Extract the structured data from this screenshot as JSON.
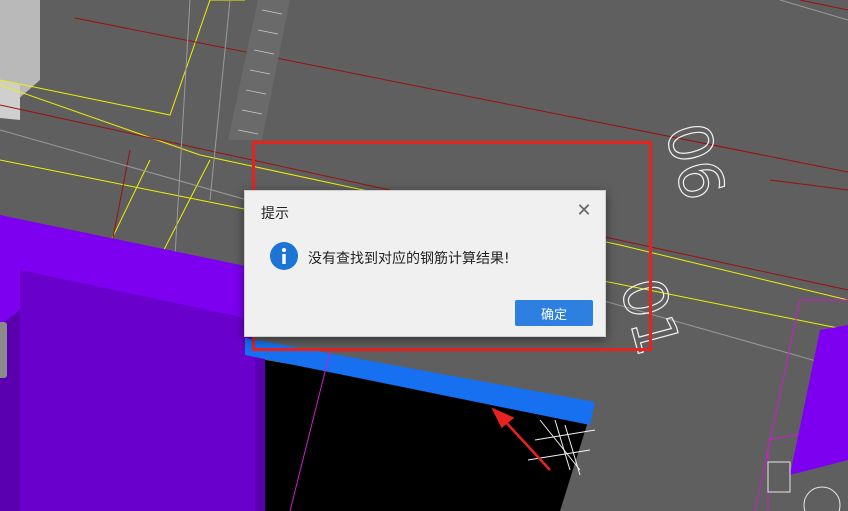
{
  "dialog": {
    "title": "提示",
    "message": "没有查找到对应的钢筋计算结果!",
    "ok_label": "确定",
    "close_icon": "close-icon",
    "info_icon": "info-icon"
  },
  "canvas": {
    "dimension_label_top": "06",
    "dimension_label_right": "01"
  },
  "colors": {
    "background": "#5f5f5f",
    "purple_fill": "#7d00f0",
    "blue_beam": "#1670f0",
    "highlight": "#e8231f",
    "button": "#2d7fe0"
  }
}
